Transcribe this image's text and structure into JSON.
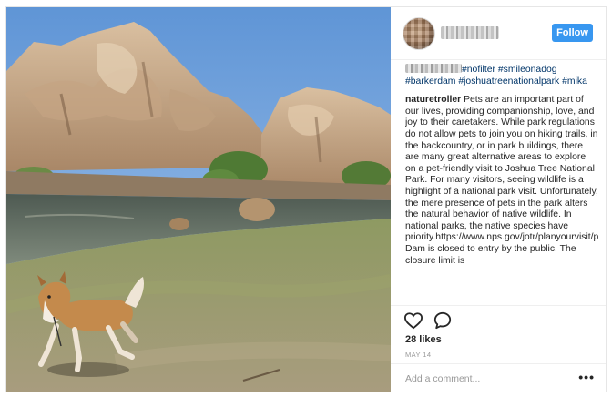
{
  "header": {
    "follow_label": "Follow"
  },
  "caption": {
    "hashtags": "#nofilter #smileonadog #barkerdam #joshuatreenationalpark #mika",
    "author": "naturetroller",
    "text": " Pets are an important part of our lives, providing companionship, love, and joy to their caretakers. While park regulations do not allow pets to join you on hiking trails, in the backcountry, or in park buildings, there are many great alternative areas to explore on a pet-friendly visit to Joshua Tree National Park. For many visitors, seeing wildlife is a highlight of a national park visit. Unfortunately, the mere presence of pets in the park alters the natural behavior of native wildlife. In national parks, the native species have priority.https://www.nps.gov/jotr/planyourvisit/pets.htmBarker Dam is closed to entry by the public. The closure limit is"
  },
  "stats": {
    "likes": "28 likes",
    "date": "MAY 14"
  },
  "comment": {
    "placeholder": "Add a comment...",
    "more": "•••"
  },
  "icons": {
    "like": "heart-icon",
    "comment": "speech-bubble-icon",
    "more": "more-options-icon"
  },
  "colors": {
    "accent": "#3897f0",
    "hashtag": "#003569",
    "text": "#262626",
    "muted": "#999999"
  }
}
